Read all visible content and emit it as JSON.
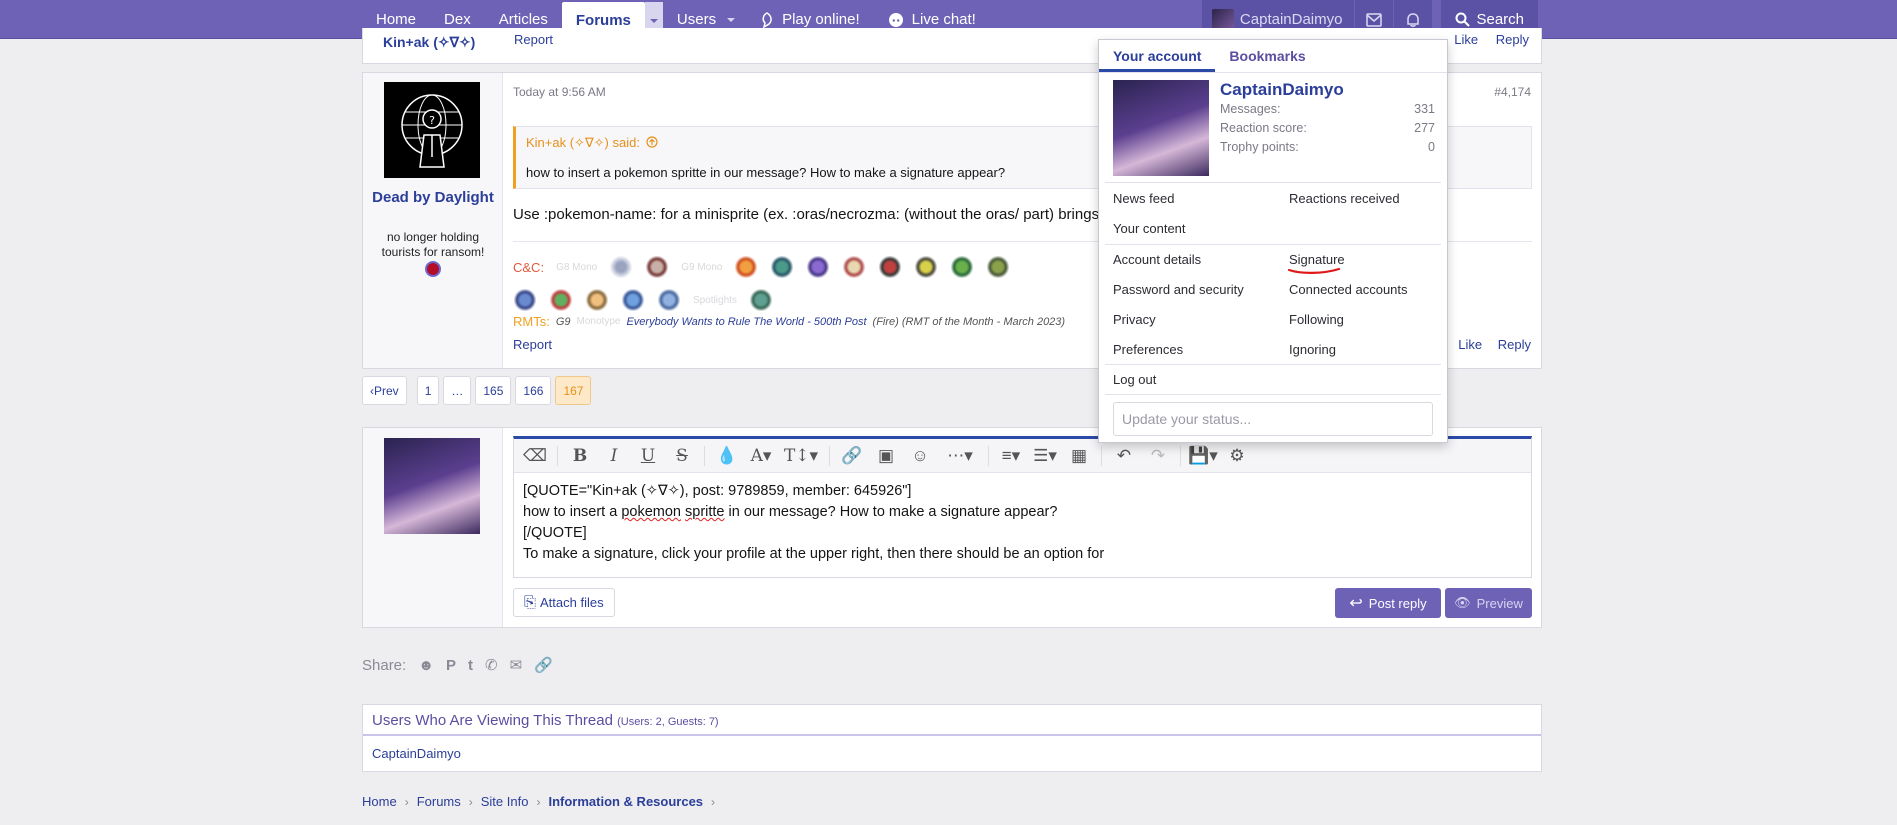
{
  "nav": {
    "items": [
      "Home",
      "Dex",
      "Articles",
      "Forums",
      "Users",
      "Play online!",
      "Live chat!"
    ],
    "account_name": "CaptainDaimyo",
    "search_label": "Search"
  },
  "prev_post": {
    "author": "Kin+ak (✧∇✧)",
    "report": "Report",
    "like": "Like",
    "reply": "Reply"
  },
  "post": {
    "date": "Today at 9:56 AM",
    "number": "#4,174",
    "author": "Dead by Daylight",
    "user_title": "no longer holding tourists for ransom!",
    "quote_head": "Kin+ak (✧∇✧) said:",
    "quote_body": "how to insert a pokemon spritte in our message? How to make a signature appear?",
    "message": "Use :pokemon-name: for a minisprite (ex. :oras/necrozma: (without the oras/ part) brings",
    "sig_cc": "C&C:",
    "sig_g8": "G8 Mono",
    "sig_g9": "G9 Mono",
    "sig_spotlight": "Spotlights",
    "sig_rmts": "RMTs:",
    "sig_g9b": "G9",
    "sig_monotype": "Monotype",
    "sig_rmt_link": "Everybody Wants to Rule The World - 500th Post",
    "sig_rmt_meta": "(Fire) (RMT of the Month - March 2023)",
    "report": "Report",
    "like": "Like",
    "reply": "Reply"
  },
  "pagination": {
    "prev": "Prev",
    "pages": [
      "1",
      "…",
      "165",
      "166",
      "167"
    ],
    "current": "167"
  },
  "editor": {
    "lines": [
      "[QUOTE=\"Kin+ak (✧∇✧), post: 9789859, member: 645926\"]",
      "how to insert a ",
      "pokemon",
      " ",
      "spritte",
      " in our message? How to make a signature appear?",
      "[/QUOTE]",
      "To make a signature, click your profile at the upper right, then there should be an option for"
    ],
    "attach": "Attach files",
    "post_reply": "Post reply",
    "preview": "Preview"
  },
  "share_label": "Share:",
  "viewing": {
    "title": "Users Who Are Viewing This Thread",
    "counts": "(Users: 2, Guests: 7)",
    "users": "CaptainDaimyo"
  },
  "breadcrumb": [
    "Home",
    "Forums",
    "Site Info",
    "Information & Resources"
  ],
  "account_menu": {
    "tabs": [
      "Your account",
      "Bookmarks"
    ],
    "name": "CaptainDaimyo",
    "stats": [
      {
        "label": "Messages:",
        "value": "331"
      },
      {
        "label": "Reaction score:",
        "value": "277"
      },
      {
        "label": "Trophy points:",
        "value": "0"
      }
    ],
    "links_left": [
      "News feed",
      "Your content",
      "Account details",
      "Password and security",
      "Privacy",
      "Preferences"
    ],
    "links_right": [
      "Reactions received",
      "Signature",
      "Connected accounts",
      "Following",
      "Ignoring"
    ],
    "logout": "Log out",
    "status_placeholder": "Update your status..."
  },
  "colors": {
    "nav_bg": "#6e62b6",
    "link": "#2b3e99",
    "accent_orange": "#e6901a"
  }
}
